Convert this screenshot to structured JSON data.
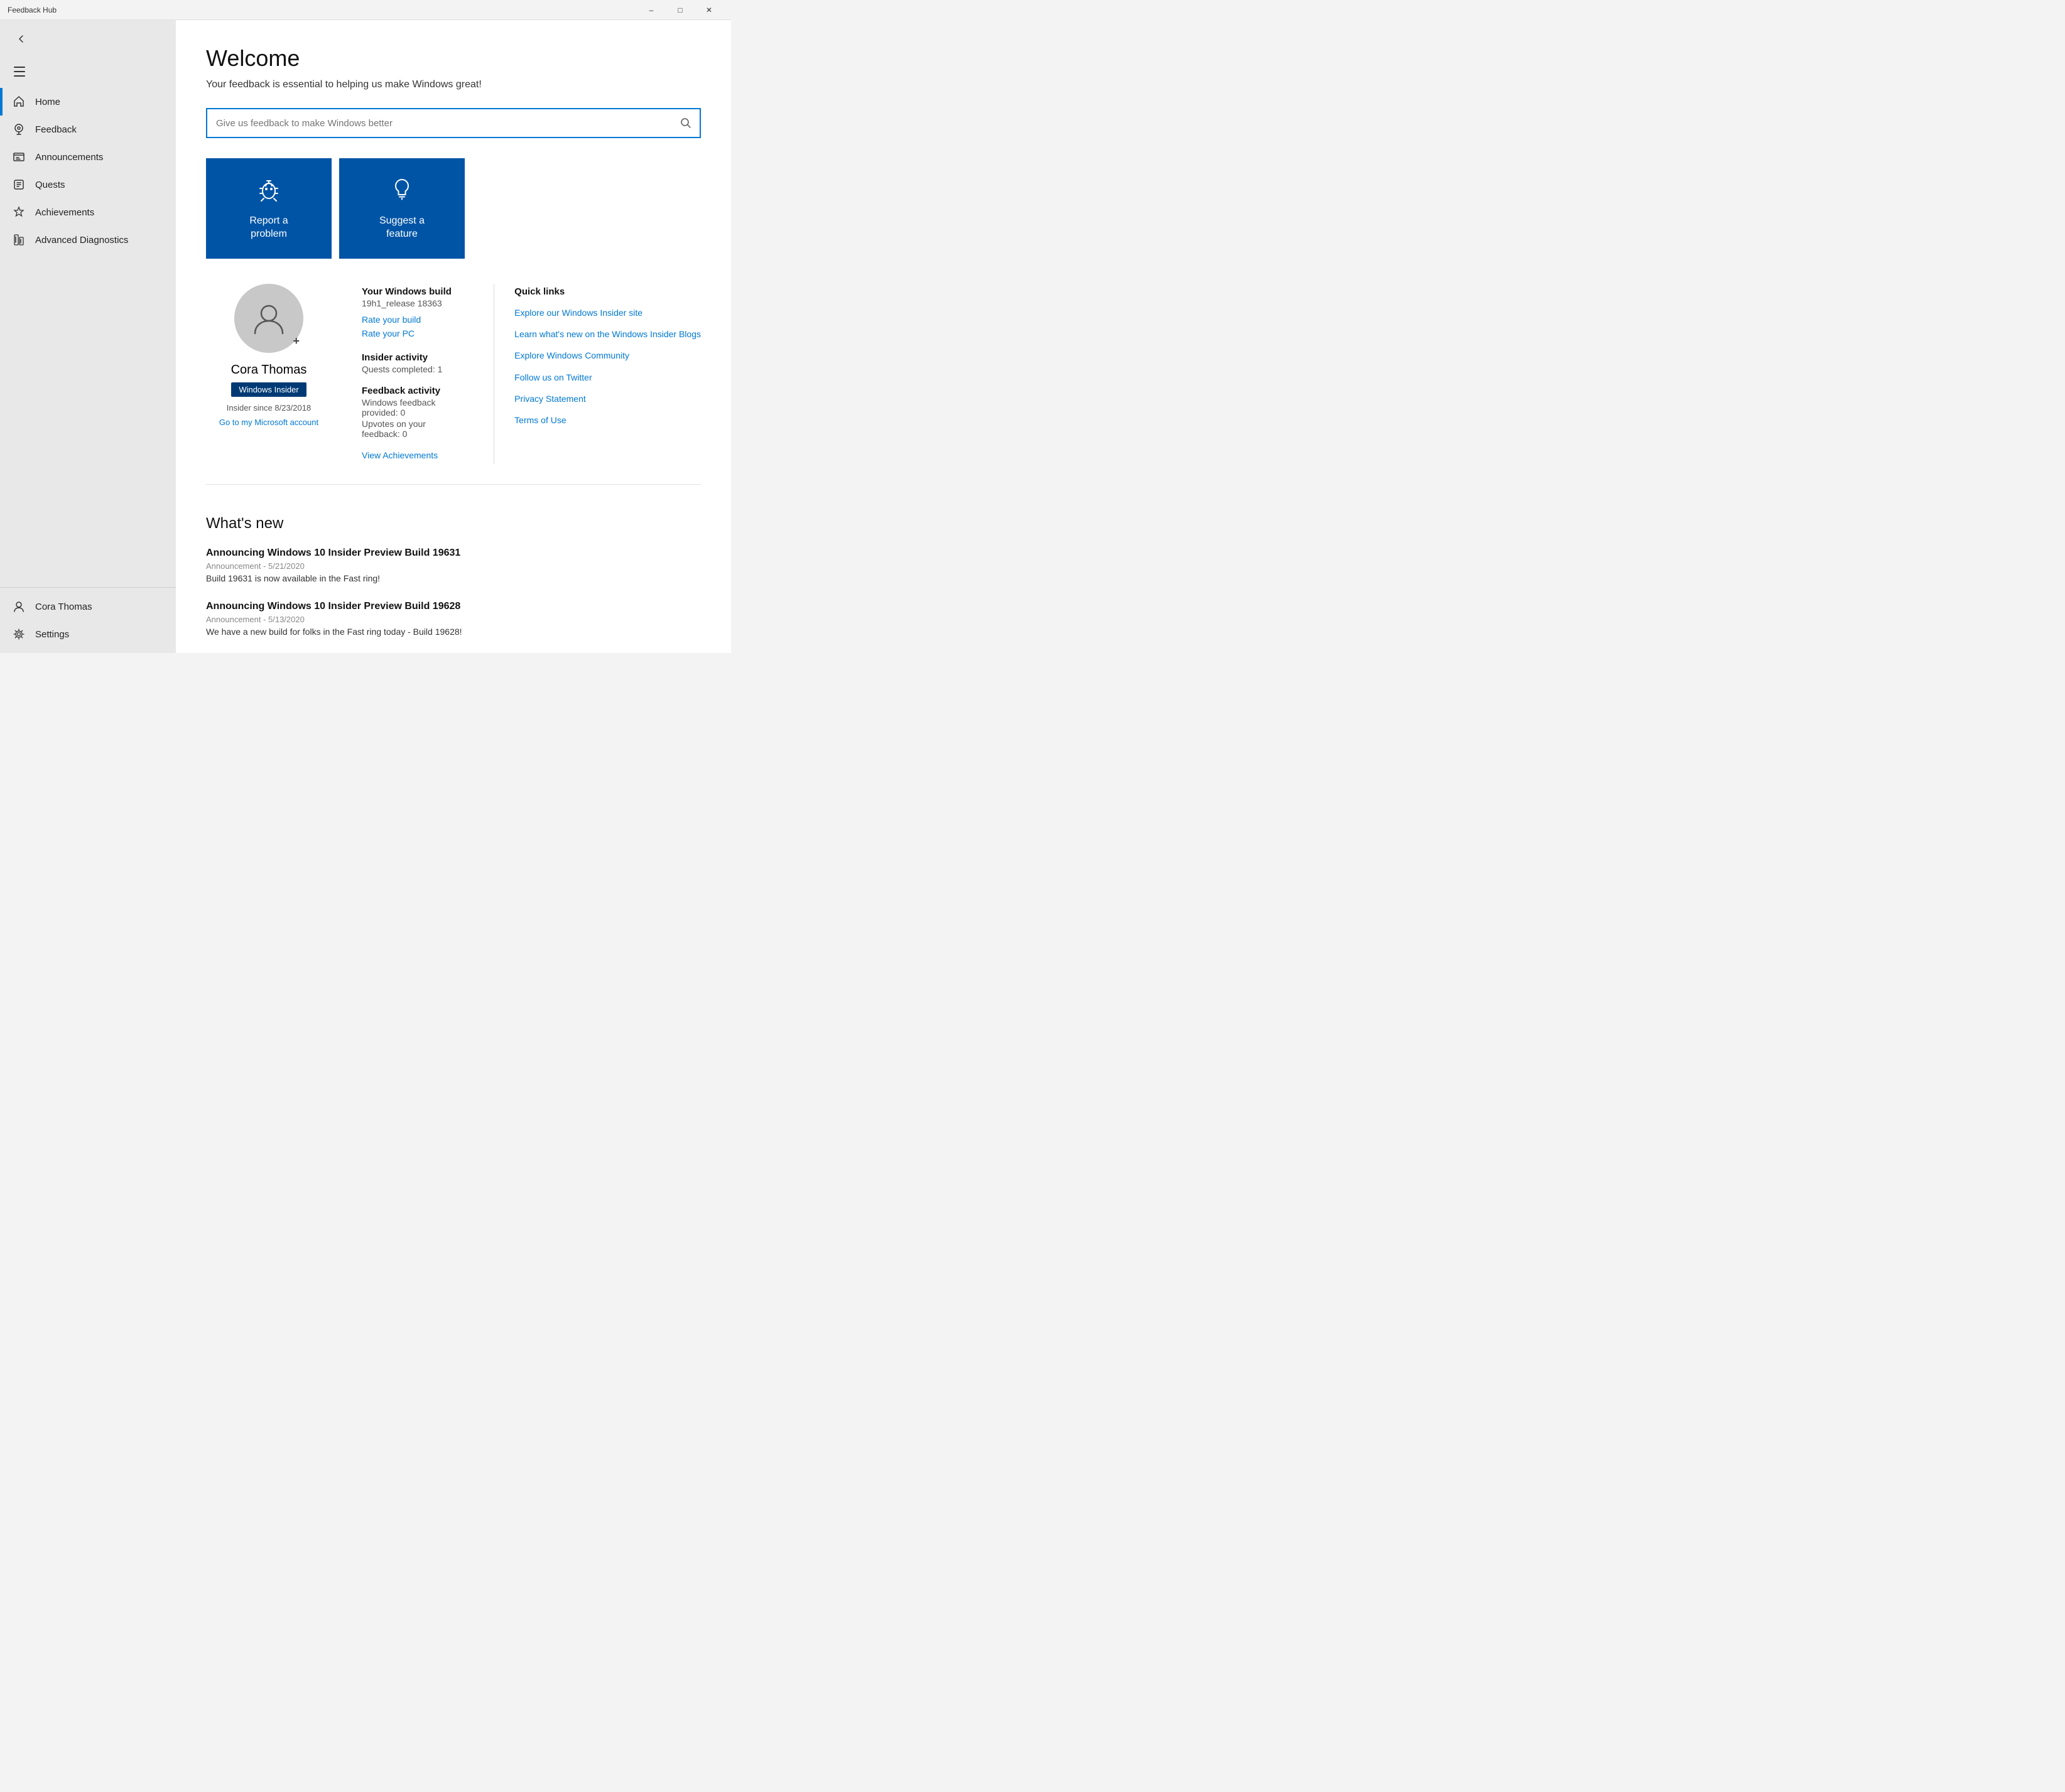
{
  "titlebar": {
    "title": "Feedback Hub",
    "minimize": "–",
    "maximize": "□",
    "close": "✕"
  },
  "sidebar": {
    "hamburger_label": "Menu",
    "back_label": "Back",
    "nav_items": [
      {
        "id": "home",
        "label": "Home",
        "icon": "home",
        "active": true
      },
      {
        "id": "feedback",
        "label": "Feedback",
        "icon": "feedback",
        "active": false
      },
      {
        "id": "announcements",
        "label": "Announcements",
        "icon": "announcements",
        "active": false
      },
      {
        "id": "quests",
        "label": "Quests",
        "icon": "quests",
        "active": false
      },
      {
        "id": "achievements",
        "label": "Achievements",
        "icon": "achievements",
        "active": false
      },
      {
        "id": "advanced",
        "label": "Advanced Diagnostics",
        "icon": "diagnostics",
        "active": false
      }
    ],
    "bottom_items": [
      {
        "id": "user",
        "label": "Cora Thomas",
        "icon": "user"
      },
      {
        "id": "settings",
        "label": "Settings",
        "icon": "settings"
      }
    ]
  },
  "main": {
    "welcome_title": "Welcome",
    "welcome_subtitle": "Your feedback is essential to helping us make Windows great!",
    "search_placeholder": "Give us feedback to make Windows better",
    "action_buttons": [
      {
        "id": "report",
        "label": "Report a\nproblem",
        "icon": "bug"
      },
      {
        "id": "suggest",
        "label": "Suggest a\nfeature",
        "icon": "lightbulb"
      }
    ],
    "profile": {
      "name": "Cora Thomas",
      "badge": "Windows Insider",
      "insider_since": "Insider since 8/23/2018",
      "account_link": "Go to my Microsoft account",
      "build_label": "Your Windows build",
      "build_value": "19h1_release 18363",
      "rate_build": "Rate your build",
      "rate_pc": "Rate your PC",
      "insider_activity_label": "Insider activity",
      "quests_completed": "Quests completed: 1",
      "feedback_activity_label": "Feedback activity",
      "feedback_provided": "Windows feedback provided: 0",
      "upvotes": "Upvotes on your feedback: 0",
      "view_achievements": "View Achievements"
    },
    "quick_links": {
      "title": "Quick links",
      "links": [
        {
          "id": "insider-site",
          "label": "Explore our Windows Insider site"
        },
        {
          "id": "insider-blogs",
          "label": "Learn what's new on the Windows Insider Blogs"
        },
        {
          "id": "community",
          "label": "Explore Windows Community"
        },
        {
          "id": "twitter",
          "label": "Follow us on Twitter"
        },
        {
          "id": "privacy",
          "label": "Privacy Statement"
        },
        {
          "id": "terms",
          "label": "Terms of Use"
        }
      ]
    },
    "whats_new": {
      "title": "What's new",
      "items": [
        {
          "id": "build-19631",
          "title": "Announcing Windows 10 Insider Preview Build 19631",
          "meta": "Announcement  -  5/21/2020",
          "description": "Build 19631 is now available in the Fast ring!"
        },
        {
          "id": "build-19628",
          "title": "Announcing Windows 10 Insider Preview Build 19628",
          "meta": "Announcement  -  5/13/2020",
          "description": "We have a new build for folks in the Fast ring today - Build 19628!"
        }
      ]
    }
  }
}
